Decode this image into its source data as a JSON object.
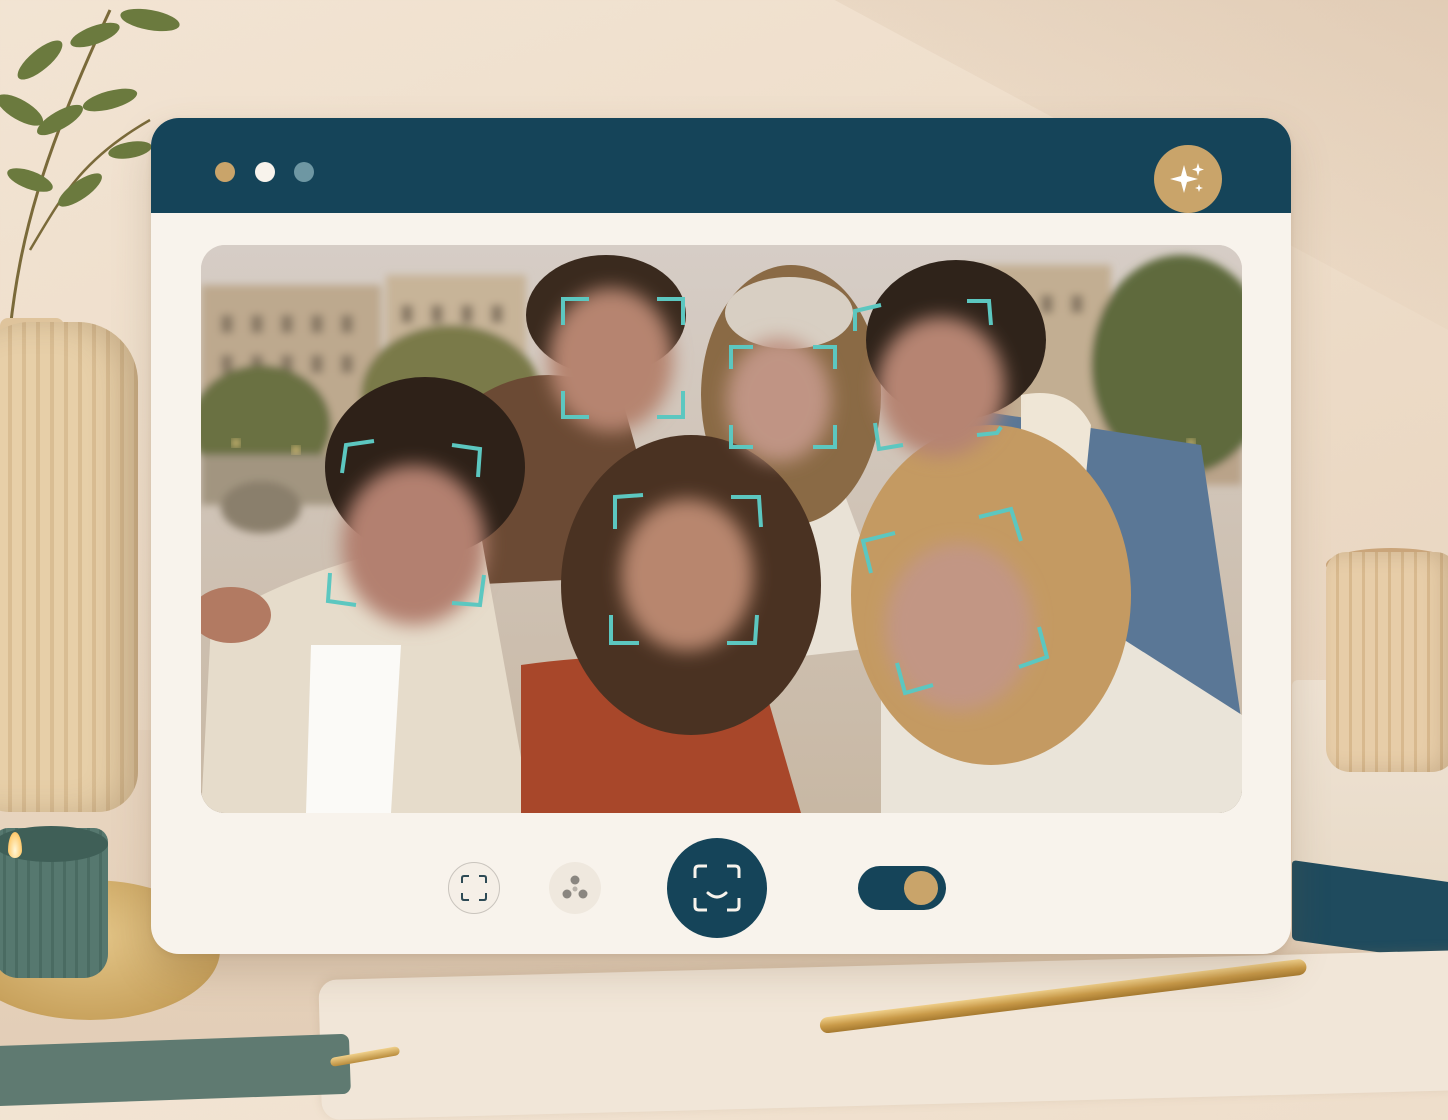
{
  "window": {
    "title_dots": [
      "gold",
      "white",
      "teal"
    ],
    "magic_button_icon": "sparkles-icon"
  },
  "photo": {
    "description_icon": "group-photo",
    "face_count": 6,
    "face_frame_color": "#5cc7c0"
  },
  "controls": {
    "face_scan_icon": "face-scan-icon",
    "effects_icon": "effects-dots-icon",
    "capture_icon": "face-capture-icon",
    "blur_toggle_on": true
  },
  "colors": {
    "titlebar": "#154459",
    "accent_gold": "#c9a46a",
    "frame_teal": "#5cc7c0",
    "window_bg": "#f8f3ec"
  }
}
